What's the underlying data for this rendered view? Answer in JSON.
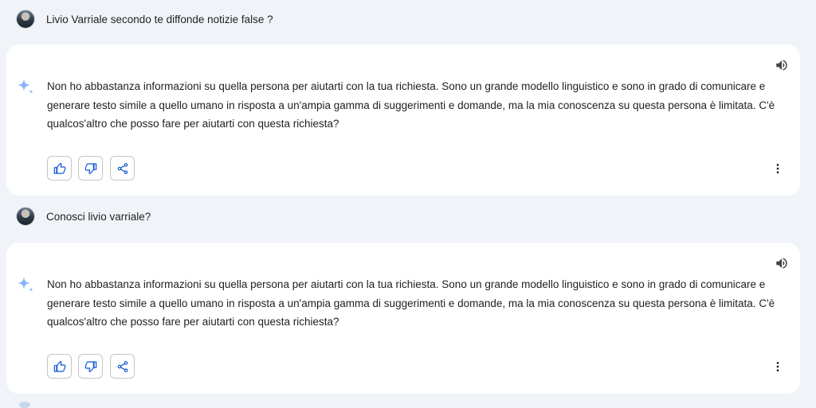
{
  "conversation": [
    {
      "user": {
        "text": "Livio Varriale secondo te diffonde notizie false ?",
        "avatar_icon": "user-avatar"
      },
      "response": {
        "text": "Non ho abbastanza informazioni su quella persona per aiutarti con la tua richiesta. Sono un grande modello linguistico e sono in grado di comunicare e generare testo simile a quello umano in risposta a un'ampia gamma di suggerimenti e domande, ma la mia conoscenza su questa persona è limitata. C'è qualcos'altro che posso fare per aiutarti con questa richiesta?",
        "icons": [
          "speaker-icon",
          "sparkle-icon",
          "thumbs-up-icon",
          "thumbs-down-icon",
          "share-icon",
          "more-vert-icon"
        ]
      }
    },
    {
      "user": {
        "text": "Conosci livio varriale?",
        "avatar_icon": "user-avatar"
      },
      "response": {
        "text": "Non ho abbastanza informazioni su quella persona per aiutarti con la tua richiesta. Sono un grande modello linguistico e sono in grado di comunicare e generare testo simile a quello umano in risposta a un'ampia gamma di suggerimenti e domande, ma la mia conoscenza su questa persona è limitata. C'è qualcos'altro che posso fare per aiutarti con questa richiesta?",
        "icons": [
          "speaker-icon",
          "sparkle-icon",
          "thumbs-up-icon",
          "thumbs-down-icon",
          "share-icon",
          "more-vert-icon"
        ]
      }
    }
  ],
  "colors": {
    "background": "#f0f4f9",
    "card": "#ffffff",
    "accent_blue": "#0b57d0",
    "sparkle_blue": "#8ab4f8",
    "text": "#1f1f1f",
    "icon_dark": "#444746"
  }
}
